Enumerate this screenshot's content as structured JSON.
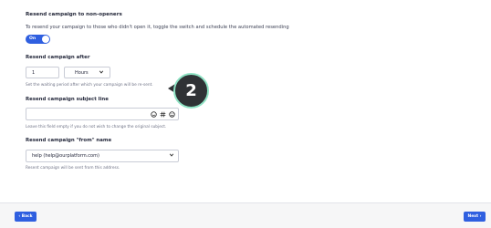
{
  "section": {
    "title": "Resend campaign to non-openers",
    "description": "To resend your campaign to those who didn't open it, toggle the switch and schedule the automated resending"
  },
  "toggle": {
    "label": "On",
    "state": "on"
  },
  "resend_after": {
    "label": "Resend campaign after",
    "value": "1",
    "unit": "Hours",
    "help": "Set the waiting period after which your campaign will be re-sent."
  },
  "subject": {
    "label": "Resend campaign subject line",
    "value": "",
    "icons": [
      "emoji-circle-icon",
      "hash-icon",
      "smiley-icon"
    ],
    "help": "Leave this field empty if you do not wish to change the original subject."
  },
  "from_name": {
    "label": "Resend campaign \"from\" name",
    "value": "help (help@ourplatform.com)",
    "help": "Resent campaign will be sent from this address."
  },
  "step_badge": "2",
  "footer": {
    "back_label": "‹ Back",
    "next_label": "Next ›"
  },
  "colors": {
    "accent": "#2f5fe0",
    "badge_bg": "#2f3235",
    "badge_ring": "#8fe3c4"
  }
}
